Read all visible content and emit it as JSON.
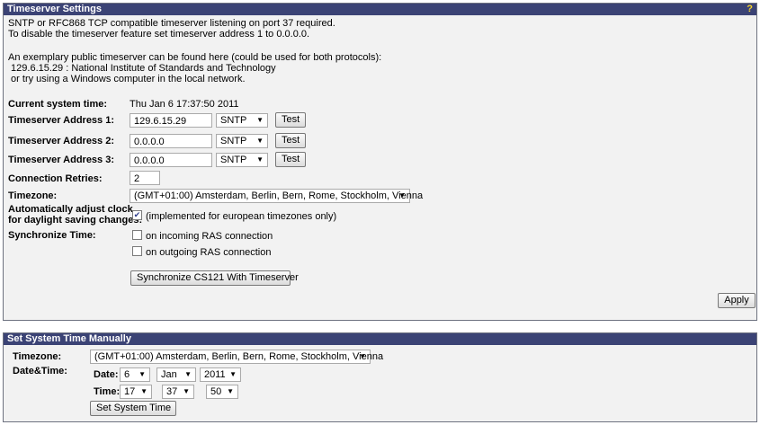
{
  "ts": {
    "title": "Timeserver Settings",
    "help": "?",
    "info": [
      "SNTP or RFC868 TCP compatible timeserver listening on port 37 required.",
      "To disable the timeserver feature set timeserver address 1 to 0.0.0.0.",
      "An exemplary public timeserver can be found here (could be used for both protocols):",
      " 129.6.15.29 : National Institute of Standards and Technology",
      " or try using a Windows computer in the local network."
    ],
    "current_time_label": "Current system time:",
    "current_time_value": "Thu Jan 6 17:37:50 2011",
    "addresses": [
      {
        "label": "Timeserver Address 1:",
        "value": "129.6.15.29",
        "protocol": "SNTP",
        "test": "Test"
      },
      {
        "label": "Timeserver Address 2:",
        "value": "0.0.0.0",
        "protocol": "SNTP",
        "test": "Test"
      },
      {
        "label": "Timeserver Address 3:",
        "value": "0.0.0.0",
        "protocol": "SNTP",
        "test": "Test"
      }
    ],
    "retries_label": "Connection Retries:",
    "retries_value": "2",
    "timezone_label": "Timezone:",
    "timezone_value": "(GMT+01:00) Amsterdam, Berlin, Bern, Rome, Stockholm, Vienna",
    "dst_label_1": "Automatically adjust clock",
    "dst_label_2": "for daylight saving changes:",
    "dst_text": "(implemented for european timezones only)",
    "dst_checked": true,
    "sync_label": "Synchronize Time:",
    "sync_incoming": "on incoming RAS connection",
    "sync_outgoing": "on outgoing RAS connection",
    "sync_button": "Synchronize CS121 With Timeserver",
    "apply": "Apply"
  },
  "manual": {
    "title": "Set System Time Manually",
    "timezone_label": "Timezone:",
    "timezone_value": "(GMT+01:00) Amsterdam, Berlin, Bern, Rome, Stockholm, Vienna",
    "datetime_label": "Date&Time:",
    "date_label": "Date:",
    "day": "6",
    "month": "Jan",
    "year": "2011",
    "time_label": "Time:",
    "hour": "17",
    "minute": "37",
    "second": "50",
    "set_button": "Set System Time"
  },
  "icons": {
    "dropdown": "chevron-down-icon",
    "check": "checkmark-icon"
  },
  "colors": {
    "header_bg": "#3b4375",
    "panel_bg": "#f2f2f2",
    "help": "#f5d32a"
  }
}
